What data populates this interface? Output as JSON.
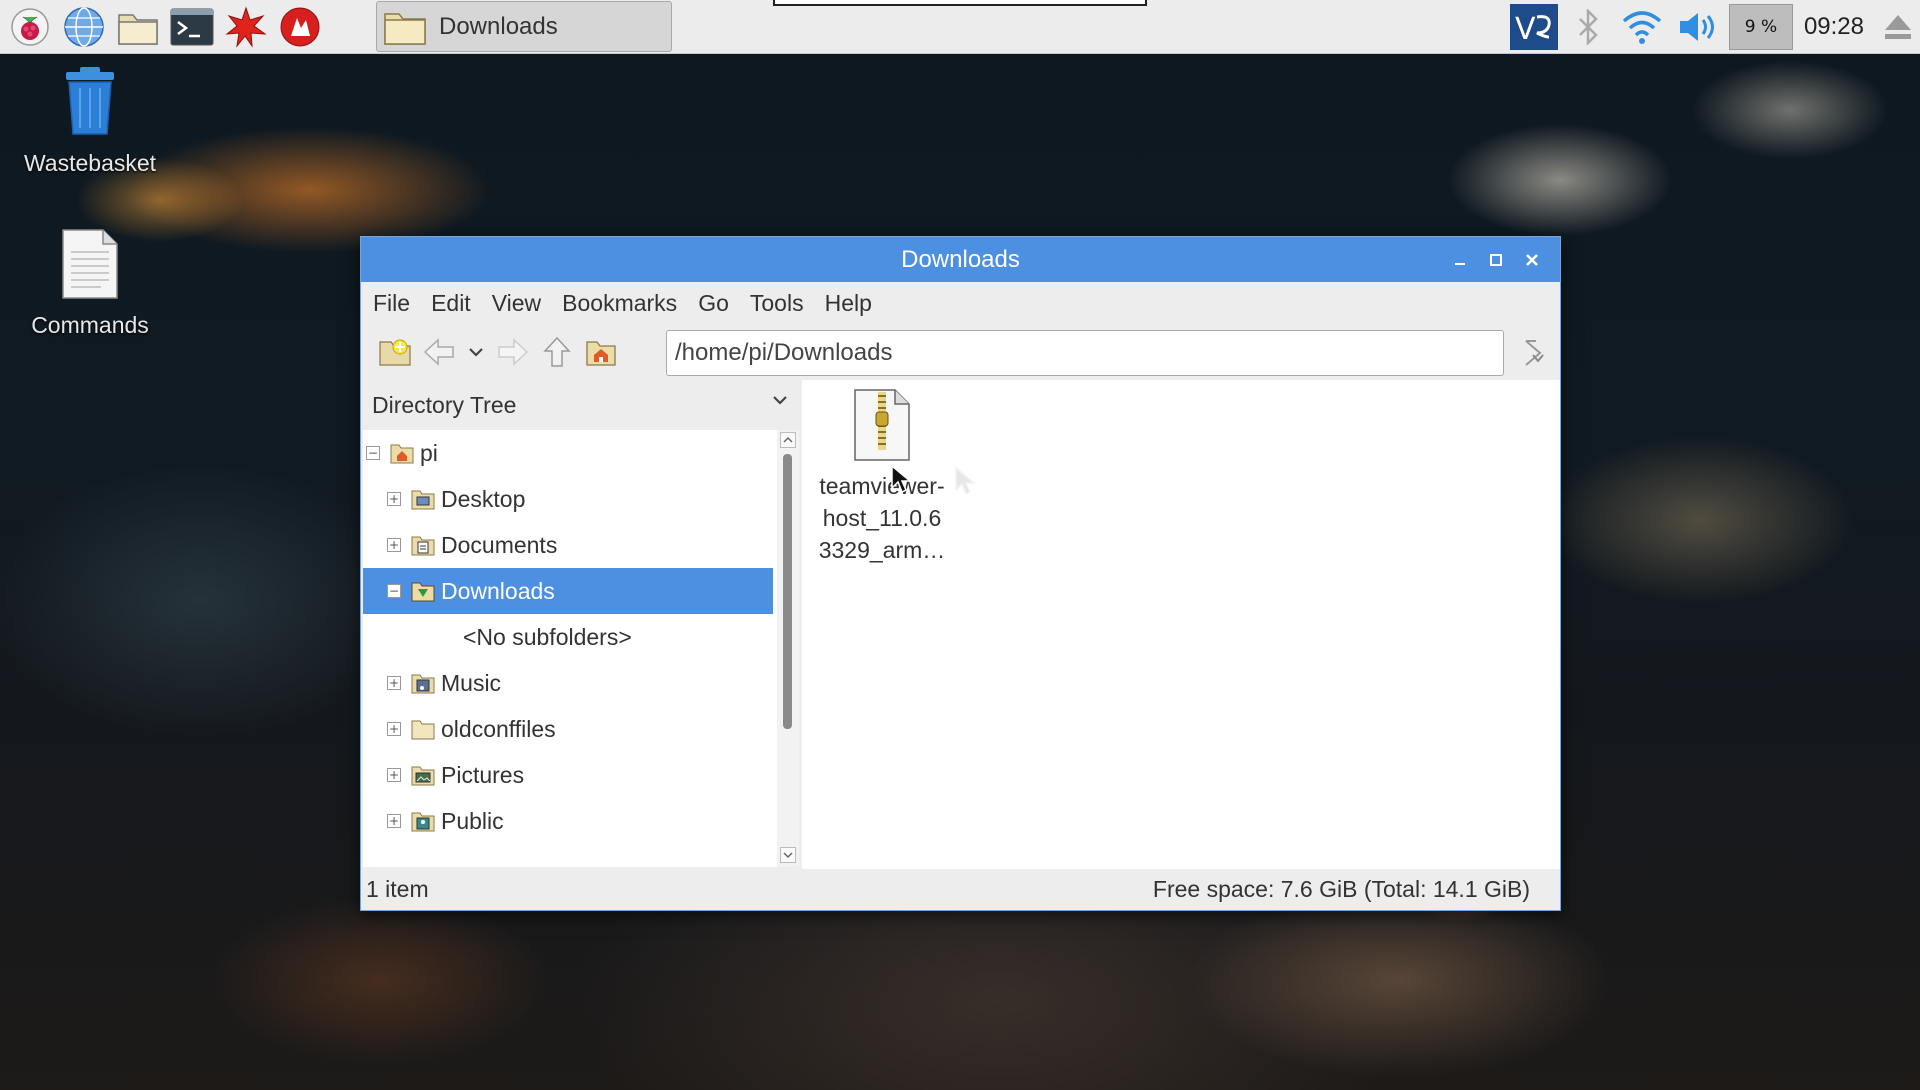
{
  "taskbar": {
    "launchers": [
      "raspberry-menu-icon",
      "web-browser-icon",
      "file-manager-icon",
      "terminal-icon",
      "mathematica-icon",
      "wolfram-icon"
    ],
    "task_label": "Downloads",
    "cpu_percent": "9 %",
    "clock": "09:28"
  },
  "desktop": {
    "icons": [
      {
        "label": "Wastebasket",
        "icon": "wastebasket-icon"
      },
      {
        "label": "Commands",
        "icon": "text-file-icon"
      }
    ]
  },
  "window": {
    "title": "Downloads",
    "menu": [
      "File",
      "Edit",
      "View",
      "Bookmarks",
      "Go",
      "Tools",
      "Help"
    ],
    "path": "/home/pi/Downloads",
    "sidebar": {
      "header": "Directory Tree",
      "tree": [
        {
          "label": "pi",
          "expander": "−"
        },
        {
          "label": "Desktop",
          "expander": "+"
        },
        {
          "label": "Documents",
          "expander": "+"
        },
        {
          "label": "Downloads",
          "expander": "−",
          "selected": true
        },
        {
          "label": "<No subfolders>"
        },
        {
          "label": "Music",
          "expander": "+"
        },
        {
          "label": "oldconffiles",
          "expander": "+"
        },
        {
          "label": "Pictures",
          "expander": "+"
        },
        {
          "label": "Public",
          "expander": "+"
        }
      ]
    },
    "files": [
      {
        "name": "teamviewer-host_11.0.63329_arm…",
        "line1": "teamviewer-",
        "line2": "host_11.0.6",
        "line3": "3329_arm…",
        "icon": "zip-archive-icon"
      }
    ],
    "status": {
      "count": "1 item",
      "free_space": "Free space: 7.6 GiB (Total: 14.1 GiB)"
    }
  },
  "colors": {
    "accent": "#4d8fe0",
    "taskbar": "#ececec",
    "window_bg": "#ededed"
  }
}
